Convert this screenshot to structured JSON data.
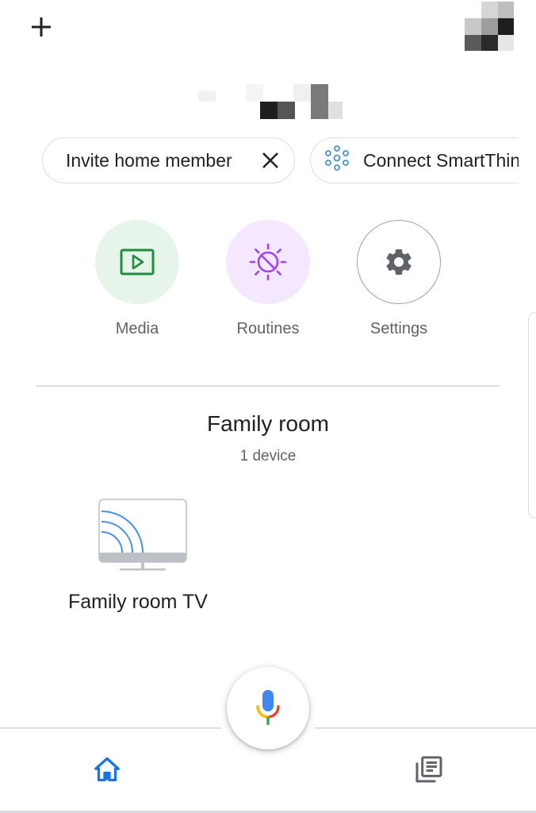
{
  "header": {
    "add_icon": "plus-icon",
    "avatar_colors": [
      "#d0d0d0",
      "#b0b0b0",
      "#4a4a4a",
      "#1e1e1e",
      "#8c8c8c",
      "#e8e8e8"
    ]
  },
  "chips": {
    "invite_label": "Invite home member",
    "invite_close_icon": "close-icon",
    "connect_label": "Connect SmartThings",
    "connect_icon": "smartthings-icon"
  },
  "actions": {
    "media_label": "Media",
    "routines_label": "Routines",
    "settings_label": "Settings"
  },
  "room": {
    "title": "Family room",
    "device_count": "1 device",
    "devices": [
      {
        "name": "Family room TV",
        "icon": "tv-cast-icon"
      }
    ]
  },
  "bottom_nav": {
    "home_icon": "home-icon",
    "feed_icon": "feed-icon",
    "mic_icon": "mic-icon"
  },
  "colors": {
    "accent_blue": "#1a73e8",
    "media_green": "#1e8e3e",
    "media_bg": "#e6f4ea",
    "routines_purple": "#a142f4",
    "routines_bg": "#f3e8fd",
    "icon_gray": "#5f6368"
  }
}
